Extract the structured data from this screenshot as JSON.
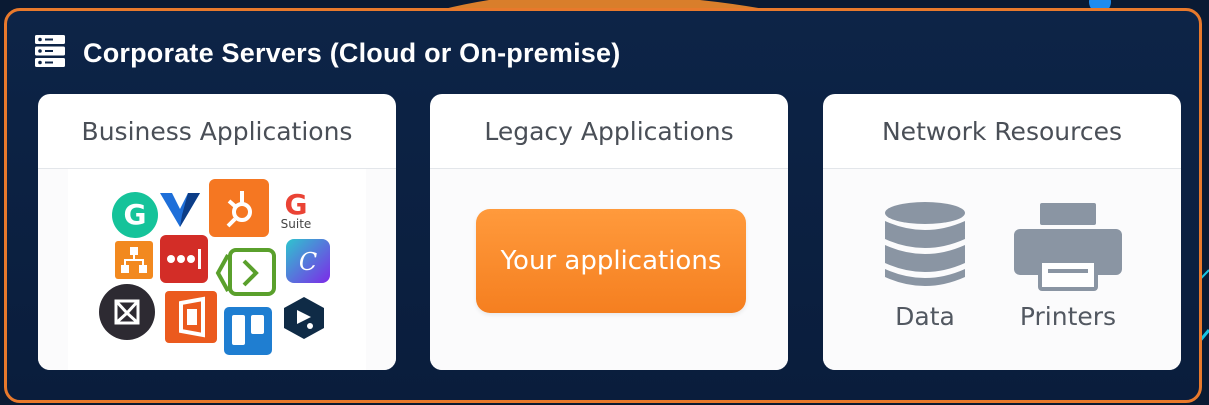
{
  "header": {
    "title": "Corporate Servers (Cloud or On-premise)",
    "icon": "server-icon"
  },
  "cards": {
    "business": {
      "title": "Business Applications",
      "logos": [
        {
          "name": "grammarly-logo",
          "color": "#15c39a"
        },
        {
          "name": "veeva-logo",
          "color": "#1e6fd9"
        },
        {
          "name": "hubspot-logo",
          "color": "#f57722"
        },
        {
          "name": "gsuite-logo",
          "text": "Suite",
          "letter": "G"
        },
        {
          "name": "lucidchart-logo",
          "color": "#f2891f"
        },
        {
          "name": "lastpass-logo",
          "color": "#d32d27"
        },
        {
          "name": "codeanywhere-logo",
          "color": "#5aa02c"
        },
        {
          "name": "canva-logo",
          "color": "#7d2ae8",
          "letter": "C"
        },
        {
          "name": "miro-logo",
          "color": "#2d2a32"
        },
        {
          "name": "office-logo",
          "color": "#eb5a1e"
        },
        {
          "name": "trello-logo",
          "color": "#1f7ed1"
        },
        {
          "name": "deepl-logo",
          "color": "#0f2b46"
        }
      ]
    },
    "legacy": {
      "title": "Legacy Applications",
      "button_label": "Your applications"
    },
    "network": {
      "title": "Network Resources",
      "items": [
        {
          "label": "Data",
          "icon": "database-icon"
        },
        {
          "label": "Printers",
          "icon": "printer-icon"
        }
      ]
    }
  },
  "colors": {
    "panel_border": "#e8792c",
    "background": "#0a1a33",
    "accent_orange": "#f57f20",
    "icon_gray": "#8a95a3"
  }
}
